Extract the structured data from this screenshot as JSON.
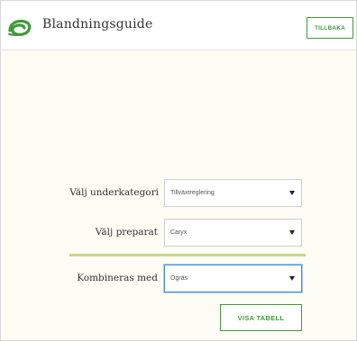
{
  "header": {
    "title": "Blandningsguide",
    "back_label": "TILLBAKA",
    "logo_icon": "leaf-swirl-icon",
    "brand_color": "#3f9b3a"
  },
  "form": {
    "subcategory": {
      "label": "Välj underkategori",
      "value": "Tillväxtreglering"
    },
    "product": {
      "label": "Välj preparat",
      "value": "Caryx"
    },
    "combine": {
      "label": "Kombineras med",
      "value": "Ogräs"
    },
    "submit_label": "VISA TABELL",
    "divider_color": "#c8d98a"
  }
}
